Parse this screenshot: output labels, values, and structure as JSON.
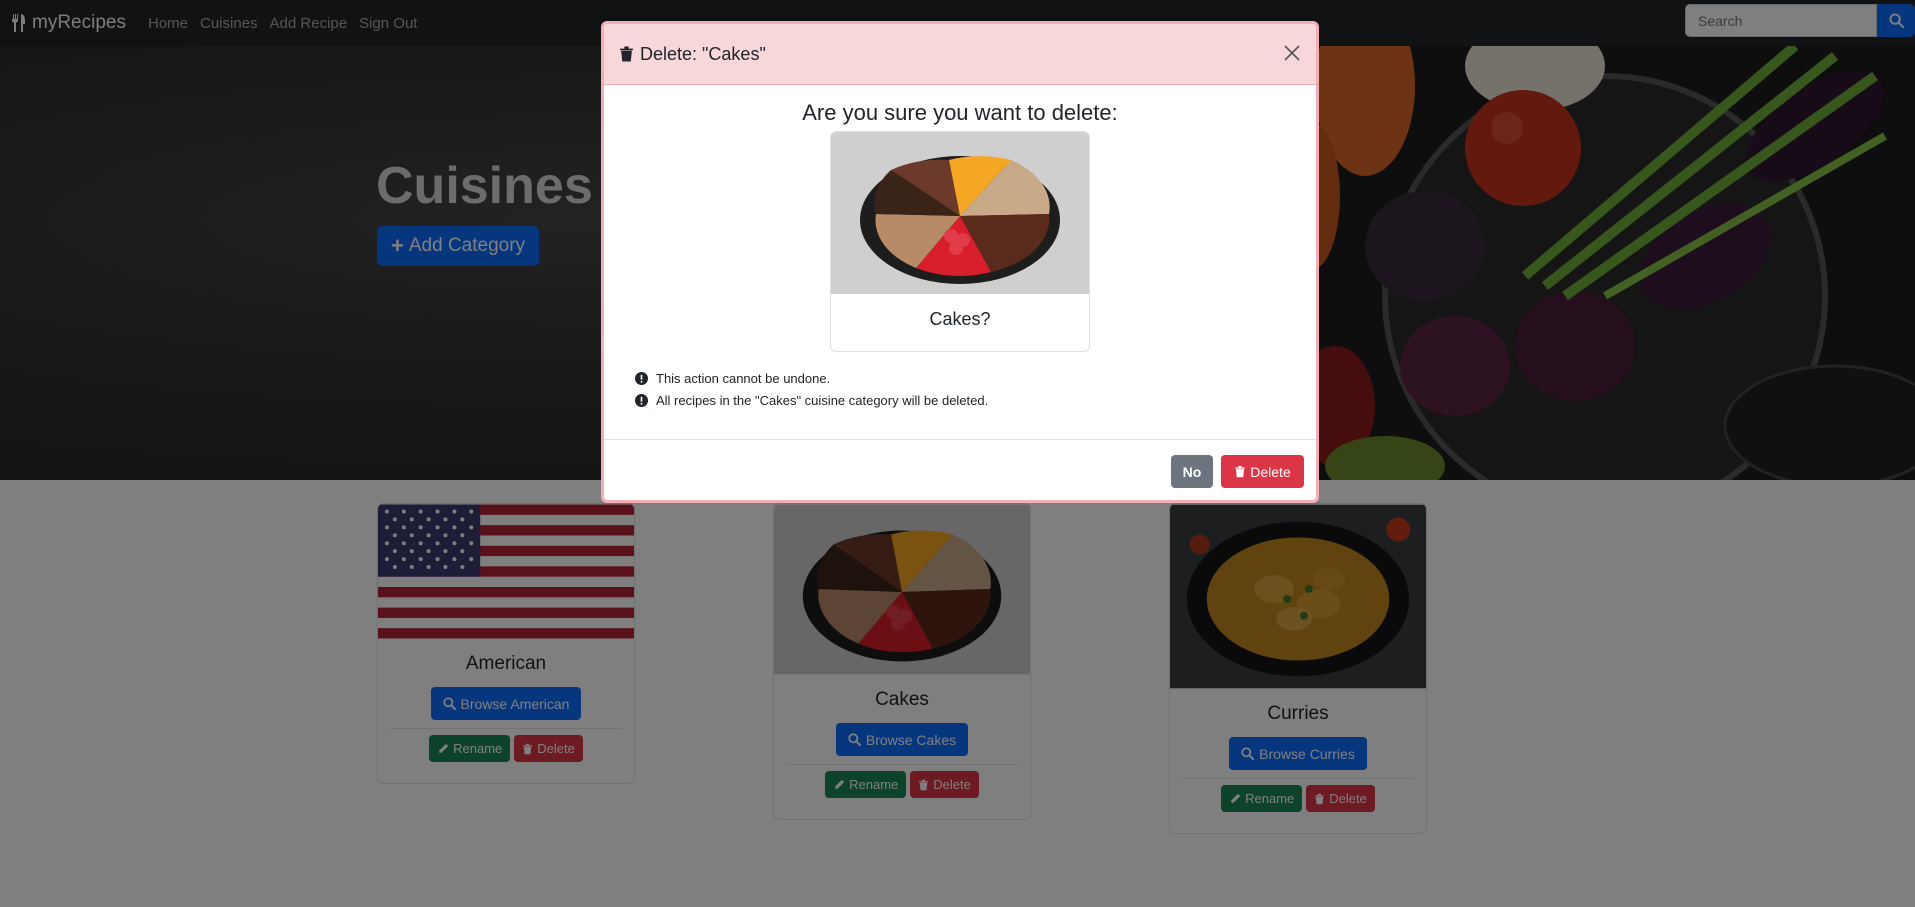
{
  "navbar": {
    "brand": "myRecipes",
    "links": [
      "Home",
      "Cuisines",
      "Add Recipe",
      "Sign Out"
    ],
    "search_placeholder": "Search"
  },
  "hero": {
    "title": "Cuisines",
    "add_button": "Add Category"
  },
  "cards": [
    {
      "title": "American",
      "browse": "Browse American",
      "rename": "Rename",
      "delete": "Delete",
      "image": "us-flag"
    },
    {
      "title": "Cakes",
      "browse": "Browse Cakes",
      "rename": "Rename",
      "delete": "Delete",
      "image": "cakes-photo"
    },
    {
      "title": "Curries",
      "browse": "Browse Curries",
      "rename": "Rename",
      "delete": "Delete",
      "image": "curry-photo"
    }
  ],
  "modal": {
    "title": "Delete: \"Cakes\"",
    "question": "Are you sure you want to delete:",
    "item_label": "Cakes?",
    "warnings": [
      "This action cannot be undone.",
      "All recipes in the \"Cakes\" cuisine category will be deleted."
    ],
    "no_label": "No",
    "delete_label": "Delete"
  },
  "colors": {
    "primary": "#0d6efd",
    "danger": "#dc3545",
    "success": "#198754",
    "secondary": "#6c757d",
    "modal_header": "#f8d7da"
  }
}
